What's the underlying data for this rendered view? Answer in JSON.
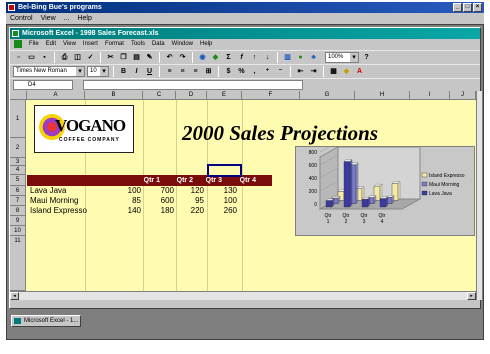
{
  "outer_window": {
    "title": "Bel-Bing Bue's programs",
    "menu": [
      "Control",
      "View",
      "...",
      "Help"
    ]
  },
  "excel_window": {
    "title": "Microsoft Excel - 1998 Sales Forecast.xls",
    "menu": [
      "File",
      "Edit",
      "View",
      "Insert",
      "Format",
      "Tools",
      "Data",
      "Window",
      "Help"
    ],
    "font_name": "Times New Roman",
    "font_size": "10",
    "zoom": "100%",
    "name_box": "D4"
  },
  "columns": [
    "A",
    "B",
    "C",
    "D",
    "E",
    "F",
    "G",
    "H",
    "I",
    "J"
  ],
  "rows": [
    "1",
    "2",
    "3",
    "4",
    "5",
    "6",
    "7",
    "8",
    "9",
    "10",
    "11"
  ],
  "logo": {
    "brand": "VOGANO",
    "subtitle": "COFFEE COMPANY"
  },
  "sheet_title": "2000 Sales Projections",
  "table": {
    "headers": [
      "Qtr 1",
      "Qtr 2",
      "Qtr 3",
      "Qtr 4"
    ],
    "rows": [
      {
        "label": "Lava Java",
        "values": [
          "100",
          "700",
          "120",
          "130"
        ]
      },
      {
        "label": "Maui Morning",
        "values": [
          "85",
          "600",
          "95",
          "100"
        ]
      },
      {
        "label": "Island Expresso",
        "values": [
          "140",
          "180",
          "220",
          "260"
        ]
      }
    ]
  },
  "chart_data": {
    "type": "bar",
    "title": "",
    "categories": [
      "Qtr 1",
      "Qtr 2",
      "Qtr 3",
      "Qtr 4"
    ],
    "series": [
      {
        "name": "Island Expresso",
        "values": [
          140,
          180,
          220,
          260
        ]
      },
      {
        "name": "Maui Morning",
        "values": [
          85,
          600,
          95,
          100
        ]
      },
      {
        "name": "Lava Java",
        "values": [
          100,
          700,
          120,
          130
        ]
      }
    ],
    "ylim": [
      0,
      800
    ],
    "yticks": [
      "800",
      "600",
      "400",
      "200",
      "0"
    ],
    "legend_position": "right",
    "colors": [
      "#f4e9a8",
      "#7a7ac8",
      "#3a3aa0"
    ]
  },
  "taskbar": {
    "item": "Microsoft Excel - 1..."
  }
}
